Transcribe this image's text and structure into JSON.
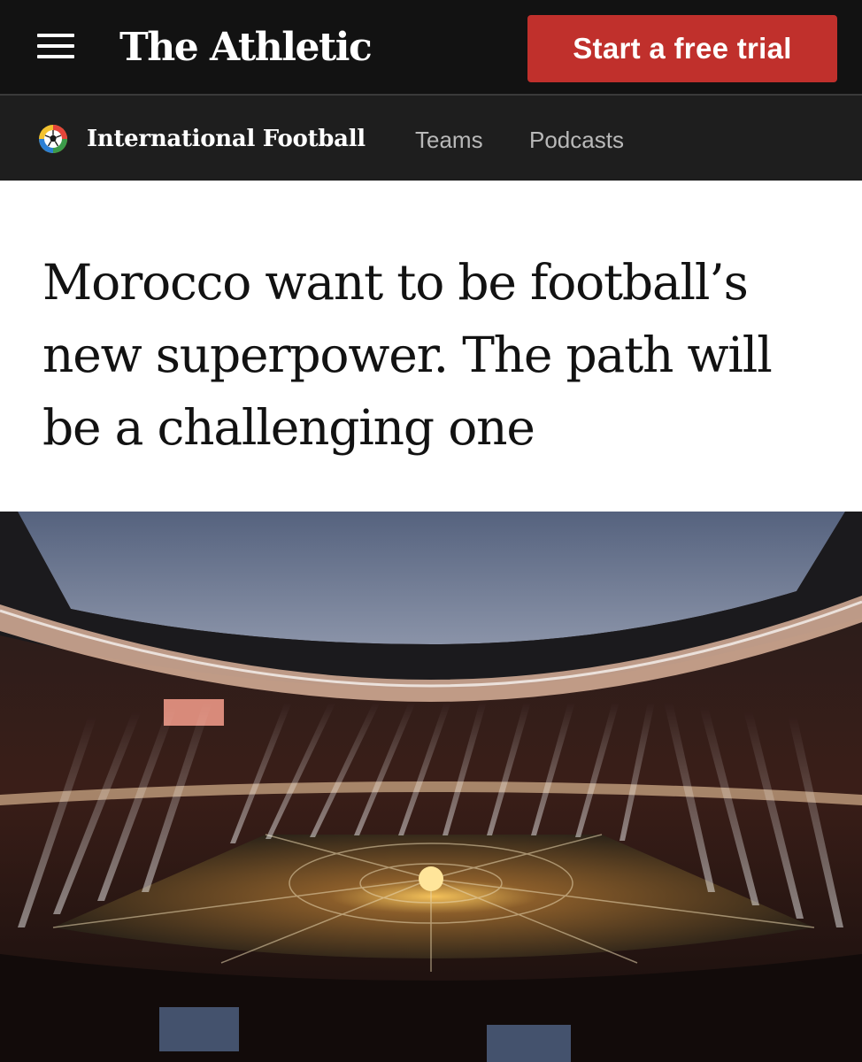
{
  "header": {
    "brand": "The Athletic",
    "cta_label": "Start a free trial",
    "cta_color": "#c0302c"
  },
  "subnav": {
    "section_title": "International Football",
    "section_icon": "football-icon",
    "links": [
      "Teams",
      "Podcasts"
    ]
  },
  "article": {
    "headline": "Morocco want to be football’s new superpower. The path will be a challenging one",
    "hero_image": "stadium-opening-ceremony-photo"
  }
}
